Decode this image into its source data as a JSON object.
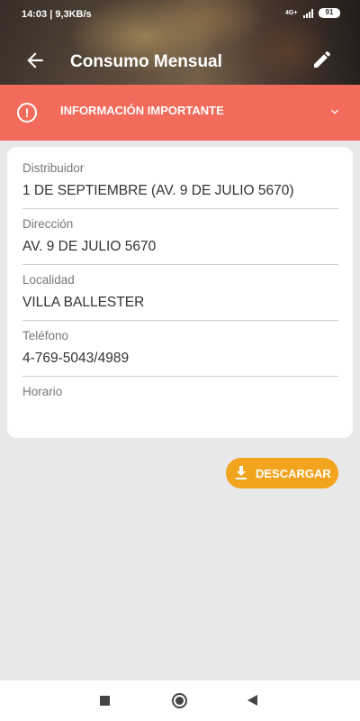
{
  "status_bar": {
    "time_speed": "14:03 | 9,3KB/s",
    "network": "4G+",
    "battery": "91"
  },
  "app_bar": {
    "title": "Consumo Mensual"
  },
  "alert": {
    "text": "INFORMACIÓN IMPORTANTE"
  },
  "distributor": {
    "fields": [
      {
        "label": "Distribuidor",
        "value": "1 DE SEPTIEMBRE (AV. 9 DE JULIO 5670)"
      },
      {
        "label": "Dirección",
        "value": "AV. 9 DE JULIO 5670"
      },
      {
        "label": "Localidad",
        "value": "VILLA BALLESTER"
      },
      {
        "label": "Teléfono",
        "value": "4-769-5043/4989"
      },
      {
        "label": "Horario",
        "value": ""
      }
    ]
  },
  "download": {
    "label": "DESCARGAR"
  },
  "colors": {
    "alert": "#f26b5b",
    "accent": "#f3a41f"
  }
}
